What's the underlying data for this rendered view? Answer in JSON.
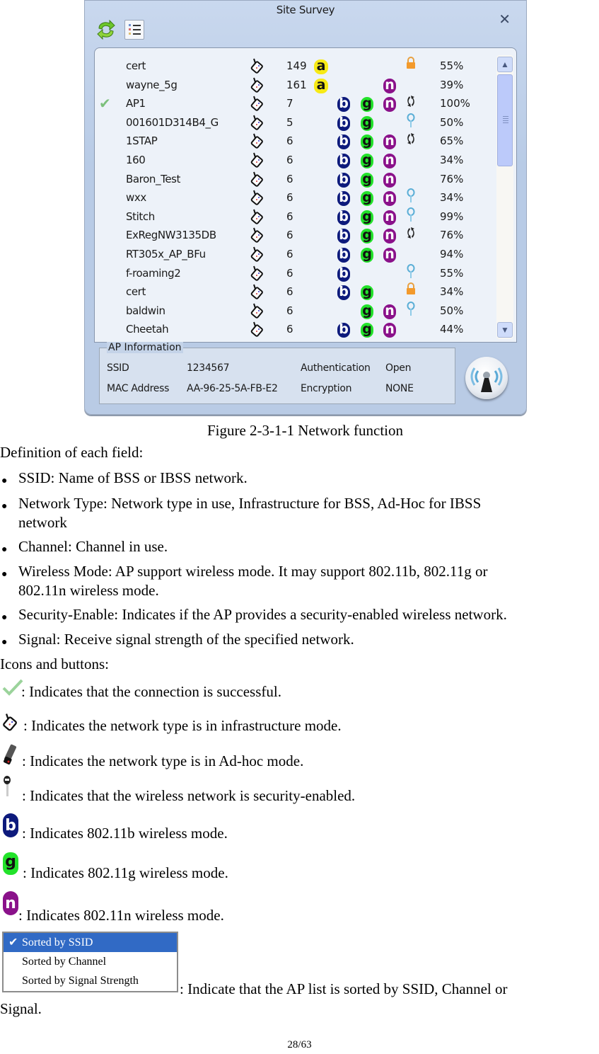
{
  "window": {
    "title": "Site Survey",
    "close_symbol": "✕",
    "toolbar": [
      "refresh-icon",
      "sort-list-icon"
    ]
  },
  "ap_list": [
    {
      "connected": false,
      "ssid": "cert",
      "type": "infrastructure",
      "channel": "149",
      "modes": [
        "a"
      ],
      "security": "lock",
      "signal": "55%"
    },
    {
      "connected": false,
      "ssid": "wayne_5g",
      "type": "infrastructure",
      "channel": "161",
      "modes": [
        "a",
        "n"
      ],
      "security": "",
      "signal": "39%"
    },
    {
      "connected": true,
      "ssid": "AP1",
      "type": "infrastructure",
      "channel": "7",
      "modes": [
        "b",
        "g",
        "n"
      ],
      "security": "wps",
      "signal": "100%"
    },
    {
      "connected": false,
      "ssid": "001601D314B4_G",
      "type": "infrastructure",
      "channel": "5",
      "modes": [
        "b",
        "g"
      ],
      "security": "key",
      "signal": "50%"
    },
    {
      "connected": false,
      "ssid": "1STAP",
      "type": "infrastructure",
      "channel": "6",
      "modes": [
        "b",
        "g",
        "n"
      ],
      "security": "wps",
      "signal": "65%"
    },
    {
      "connected": false,
      "ssid": "160",
      "type": "infrastructure",
      "channel": "6",
      "modes": [
        "b",
        "g",
        "n"
      ],
      "security": "",
      "signal": "34%"
    },
    {
      "connected": false,
      "ssid": "Baron_Test",
      "type": "infrastructure",
      "channel": "6",
      "modes": [
        "b",
        "g",
        "n"
      ],
      "security": "",
      "signal": "76%"
    },
    {
      "connected": false,
      "ssid": "wxx",
      "type": "infrastructure",
      "channel": "6",
      "modes": [
        "b",
        "g",
        "n"
      ],
      "security": "key",
      "signal": "34%"
    },
    {
      "connected": false,
      "ssid": "Stitch",
      "type": "infrastructure",
      "channel": "6",
      "modes": [
        "b",
        "g",
        "n"
      ],
      "security": "key",
      "signal": "99%"
    },
    {
      "connected": false,
      "ssid": "ExRegNW3135DB",
      "type": "infrastructure",
      "channel": "6",
      "modes": [
        "b",
        "g",
        "n"
      ],
      "security": "wps",
      "signal": "76%"
    },
    {
      "connected": false,
      "ssid": "RT305x_AP_BFu",
      "type": "infrastructure",
      "channel": "6",
      "modes": [
        "b",
        "g",
        "n"
      ],
      "security": "",
      "signal": "94%"
    },
    {
      "connected": false,
      "ssid": "f-roaming2",
      "type": "infrastructure",
      "channel": "6",
      "modes": [
        "b"
      ],
      "security": "key",
      "signal": "55%"
    },
    {
      "connected": false,
      "ssid": "cert",
      "type": "infrastructure",
      "channel": "6",
      "modes": [
        "b",
        "g"
      ],
      "security": "lock",
      "signal": "34%"
    },
    {
      "connected": false,
      "ssid": "baldwin",
      "type": "infrastructure",
      "channel": "6",
      "modes": [
        "g",
        "n"
      ],
      "security": "key",
      "signal": "50%"
    },
    {
      "connected": false,
      "ssid": "Cheetah",
      "type": "infrastructure",
      "channel": "6",
      "modes": [
        "b",
        "g",
        "n"
      ],
      "security": "",
      "signal": "44%"
    }
  ],
  "ap_info": {
    "legend": "AP Information",
    "ssid_label": "SSID",
    "ssid_value": "1234567",
    "mac_label": "MAC Address",
    "mac_value": "AA-96-25-5A-FB-E2",
    "auth_label": "Authentication",
    "auth_value": "Open",
    "enc_label": "Encryption",
    "enc_value": "NONE"
  },
  "doc": {
    "caption": "Figure 2-3-1-1 Network function",
    "definition_heading": "Definition of each field:",
    "fields": [
      {
        "lines": [
          "SSID: Name of BSS or IBSS network."
        ]
      },
      {
        "lines": [
          "Network Type: Network type in use, Infrastructure for BSS, Ad-Hoc for IBSS",
          "network"
        ]
      },
      {
        "lines": [
          "Channel: Channel in use."
        ]
      },
      {
        "lines": [
          "Wireless Mode: AP support wireless mode. It may support 802.11b, 802.11g or",
          "802.11n wireless mode."
        ]
      },
      {
        "lines": [
          "Security-Enable: Indicates if the AP provides a security-enabled wireless network."
        ]
      },
      {
        "lines": [
          "Signal: Receive signal strength of the specified network."
        ]
      }
    ],
    "icons_heading": "Icons and buttons:",
    "icon_legend": [
      {
        "icon": "check-icon",
        "text": ": Indicates that the connection is successful."
      },
      {
        "icon": "infrastructure-icon",
        "text": ": Indicates the network type is in infrastructure mode."
      },
      {
        "icon": "adhoc-icon",
        "text": ": Indicates the network type is in Ad-hoc mode."
      },
      {
        "icon": "key-icon",
        "text": ": Indicates that the wireless network is security-enabled."
      },
      {
        "icon": "mode-b-icon",
        "text": ": Indicates 802.11b wireless mode."
      },
      {
        "icon": "mode-g-icon",
        "text": ": Indicates 802.11g wireless mode."
      },
      {
        "icon": "mode-n-icon",
        "text": ": Indicates 802.11n wireless mode."
      }
    ],
    "sort_menu": {
      "options": [
        "Sorted by SSID",
        "Sorted by Channel",
        "Sorted by Signal Strength"
      ],
      "selected": "Sorted by SSID"
    },
    "sort_text_line1": ": Indicate that the AP list is sorted by SSID, Channel or",
    "sort_text_line2": "Signal.",
    "page_number": "28/63"
  },
  "colors": {
    "mode_a": "#f7ea16",
    "mode_b": "#0d1a7c",
    "mode_g": "#22e22a",
    "mode_n": "#8a118a",
    "menu_highlight": "#316ac5"
  }
}
